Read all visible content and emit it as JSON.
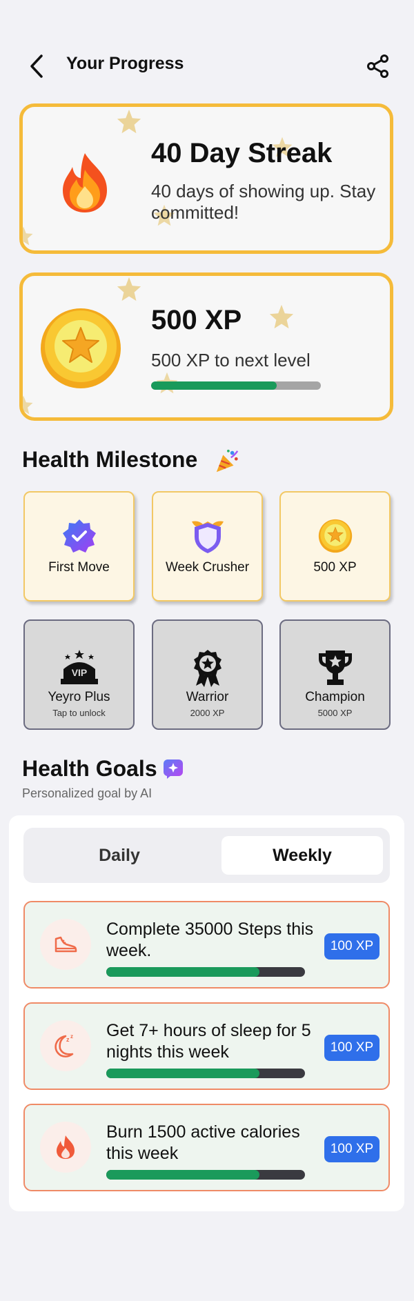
{
  "header": {
    "title": "Your Progress",
    "back_icon": "chevron-left-icon",
    "share_icon": "share-icon"
  },
  "streak": {
    "title": "40 Day Streak",
    "subtitle": "40 days of showing up. Stay committed!",
    "icon": "fire-icon"
  },
  "xp": {
    "title": "500 XP",
    "subtitle": "500 XP to next level",
    "progress": 0.74,
    "icon": "star-coin-icon"
  },
  "milestones": {
    "title": "Health Milestone",
    "icon": "party-popper-icon",
    "badges": [
      {
        "label": "First Move",
        "sub": "",
        "locked": false,
        "icon": "verified-badge-icon"
      },
      {
        "label": "Week Crusher",
        "sub": "",
        "locked": false,
        "icon": "shield-icon"
      },
      {
        "label": "500 XP",
        "sub": "",
        "locked": false,
        "icon": "star-coin-icon"
      },
      {
        "label": "Yeyro Plus",
        "sub": "Tap to unlock",
        "locked": true,
        "icon": "vip-crown-icon"
      },
      {
        "label": "Warrior",
        "sub": "2000 XP",
        "locked": true,
        "icon": "award-ribbon-icon"
      },
      {
        "label": "Champion",
        "sub": "5000 XP",
        "locked": true,
        "icon": "trophy-icon"
      }
    ]
  },
  "goals": {
    "title": "Health Goals",
    "subtitle": "Personalized goal by AI",
    "ai_icon": "ai-sparkle-icon",
    "tabs": [
      {
        "label": "Daily",
        "active": false
      },
      {
        "label": "Weekly",
        "active": true
      }
    ],
    "items": [
      {
        "text": "Complete 35000 Steps this week.",
        "reward": "100 XP",
        "progress": 0.77,
        "icon": "shoe-icon"
      },
      {
        "text": "Get 7+ hours of sleep for 5 nights this week",
        "reward": "100 XP",
        "progress": 0.77,
        "icon": "moon-sleep-icon"
      },
      {
        "text": "Burn 1500 active calories this week",
        "reward": "100 XP",
        "progress": 0.77,
        "icon": "flame-icon"
      }
    ]
  },
  "colors": {
    "card_border": "#f5bb3a",
    "progress_green": "#1a9a5b",
    "xp_badge_blue": "#2f6fea",
    "goal_border": "#ef8a66"
  }
}
